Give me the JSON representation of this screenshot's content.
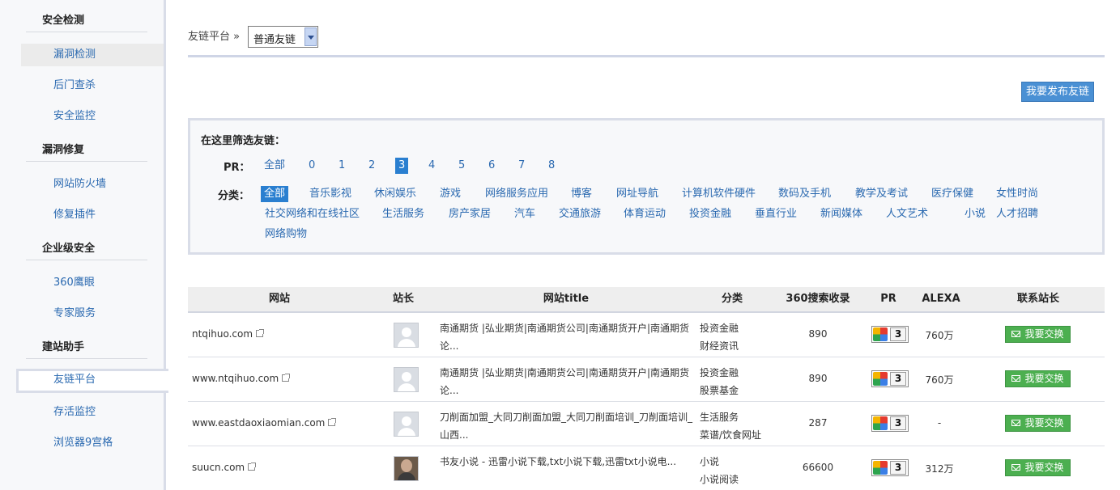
{
  "sidebar": {
    "sections": [
      {
        "title": "安全检测",
        "items": [
          "漏洞检测",
          "后门查杀",
          "安全监控"
        ]
      },
      {
        "title": "漏洞修复",
        "items": [
          "网站防火墙",
          "修复插件"
        ]
      },
      {
        "title": "企业级安全",
        "items": [
          "360鹰眼",
          "专家服务"
        ]
      },
      {
        "title": "建站助手",
        "items": [
          "友链平台",
          "存活监控",
          "浏览器9宫格"
        ]
      }
    ]
  },
  "crumb": {
    "label": "友链平台 »",
    "select_value": "普通友链"
  },
  "publish_button": "我要发布友链",
  "filter": {
    "title": "在这里筛选友链：",
    "pr_label": "PR：",
    "pr_options": [
      "全部",
      "0",
      "1",
      "2",
      "3",
      "4",
      "5",
      "6",
      "7",
      "8"
    ],
    "pr_selected": "3",
    "category_label": "分类：",
    "categories": [
      "全部",
      "音乐影视",
      "休闲娱乐",
      "游戏",
      "网络服务应用",
      "博客",
      "网址导航",
      "计算机软件硬件",
      "数码及手机",
      "教学及考试",
      "医疗保健",
      "女性时尚",
      "社交网络和在线社区",
      "生活服务",
      "房产家居",
      "汽车",
      "交通旅游",
      "体育运动",
      "投资金融",
      "垂直行业",
      "新闻媒体",
      "人文艺术",
      "小说",
      "人才招聘",
      "网络购物"
    ],
    "category_selected": "全部"
  },
  "table": {
    "headers": [
      "网站",
      "站长",
      "网站title",
      "分类",
      "360搜索收录",
      "PR",
      "ALEXA",
      "联系站长"
    ],
    "rows": [
      {
        "site": "ntqihuo.com",
        "title": "南通期货 |弘业期货|南通期货公司|南通期货开户|南通期货论...",
        "cat1": "投资金融",
        "cat2": "财经资讯",
        "count": "890",
        "pr": "3",
        "alexa": "760万",
        "action": "我要交换",
        "avatar": "default"
      },
      {
        "site": "www.ntqihuo.com",
        "title": "南通期货 |弘业期货|南通期货公司|南通期货开户|南通期货论...",
        "cat1": "投资金融",
        "cat2": "股票基金",
        "count": "890",
        "pr": "3",
        "alexa": "760万",
        "action": "我要交换",
        "avatar": "default"
      },
      {
        "site": "www.eastdaoxiaomian.com",
        "title": "刀削面加盟_大同刀削面加盟_大同刀削面培训_刀削面培训_山西...",
        "cat1": "生活服务",
        "cat2": "菜谱/饮食网址",
        "count": "287",
        "pr": "3",
        "alexa": "-",
        "action": "我要交换",
        "avatar": "default"
      },
      {
        "site": "suucn.com",
        "title": "书友小说 - 迅雷小说下载,txt小说下载,迅雷txt小说电...",
        "cat1": "小说",
        "cat2": "小说阅读",
        "count": "66600",
        "pr": "3",
        "alexa": "312万",
        "action": "我要交换",
        "avatar": "photo"
      }
    ]
  }
}
